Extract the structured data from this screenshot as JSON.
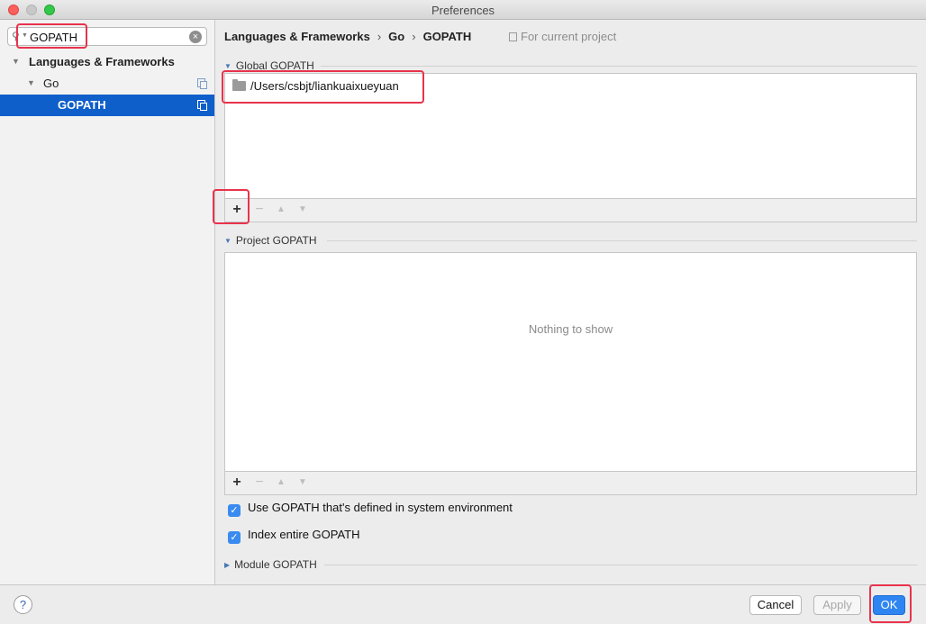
{
  "window": {
    "title": "Preferences"
  },
  "search": {
    "value": "GOPATH"
  },
  "tree": [
    {
      "label": "Languages & Frameworks"
    },
    {
      "label": "Go"
    },
    {
      "label": "GOPATH"
    }
  ],
  "breadcrumb": {
    "part1": "Languages & Frameworks",
    "part2": "Go",
    "part3": "GOPATH"
  },
  "scope_label": "For current project",
  "global_gopath": {
    "title": "Global GOPATH",
    "paths": [
      "/Users/csbjt/liankuaixueyuan"
    ]
  },
  "project_gopath": {
    "title": "Project GOPATH",
    "empty_text": "Nothing to show"
  },
  "options": {
    "use_system_gopath": "Use GOPATH that's defined in system environment",
    "index_entire_gopath": "Index entire GOPATH"
  },
  "module_gopath": {
    "title": "Module GOPATH"
  },
  "toolbar": {
    "add": "+",
    "remove": "−"
  },
  "buttons": {
    "cancel": "Cancel",
    "apply": "Apply",
    "ok": "OK",
    "help": "?"
  },
  "colors": {
    "selection": "#0f5fcb",
    "accent": "#2e85f2",
    "highlight": "#e8334c"
  }
}
